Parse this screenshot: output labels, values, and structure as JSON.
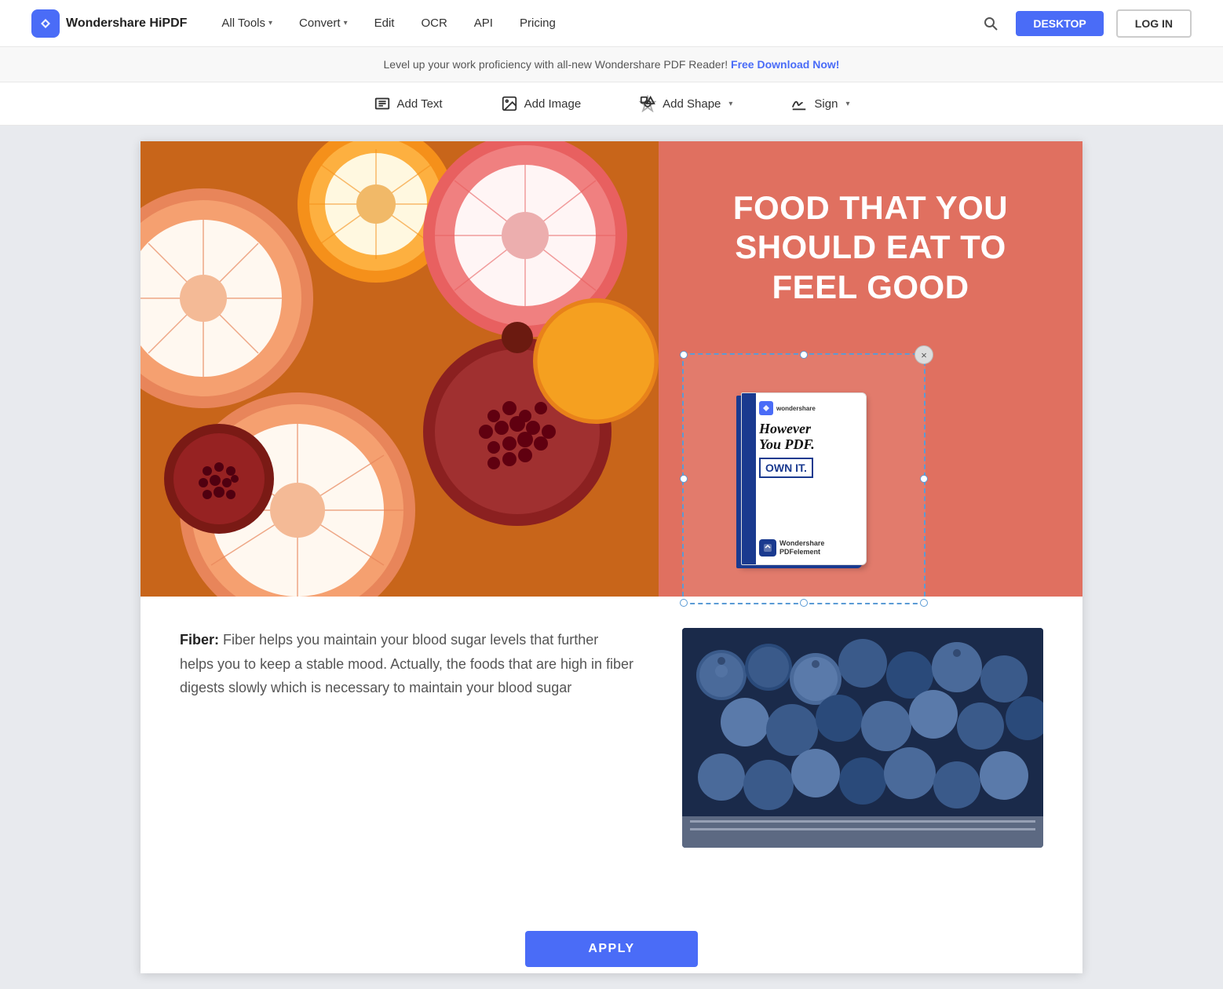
{
  "nav": {
    "logo_text": "Wondershare HiPDF",
    "links": [
      {
        "label": "All Tools",
        "has_dropdown": true
      },
      {
        "label": "Convert",
        "has_dropdown": true
      },
      {
        "label": "Edit",
        "has_dropdown": false
      },
      {
        "label": "OCR",
        "has_dropdown": false
      },
      {
        "label": "API",
        "has_dropdown": false
      },
      {
        "label": "Pricing",
        "has_dropdown": false
      }
    ],
    "btn_desktop": "DESKTOP",
    "btn_login": "LOG IN"
  },
  "banner": {
    "text": "Level up your work proficiency with all-new Wondershare PDF Reader!",
    "link_text": "Free Download Now!"
  },
  "toolbar": {
    "items": [
      {
        "label": "Add Text",
        "icon": "text-icon"
      },
      {
        "label": "Add Image",
        "icon": "image-icon"
      },
      {
        "label": "Add Shape",
        "icon": "shape-icon",
        "has_dropdown": true
      },
      {
        "label": "Sign",
        "icon": "sign-icon",
        "has_dropdown": true
      }
    ]
  },
  "page": {
    "panel_title": "FOOD THAT YOU SHOULD EAT TO FEEL GOOD",
    "book_main_text": "However\nYou PDF.",
    "book_sub_text": "OWN IT.",
    "book_brand": "Wondershare\nPDFelement",
    "body_text_label": "Fiber:",
    "body_text": " Fiber helps you maintain your blood sugar levels that further helps you to keep a stable mood. Actually, the foods that are high in fiber digests slowly which is necessary to maintain your blood sugar"
  },
  "apply_btn": "APPLY"
}
